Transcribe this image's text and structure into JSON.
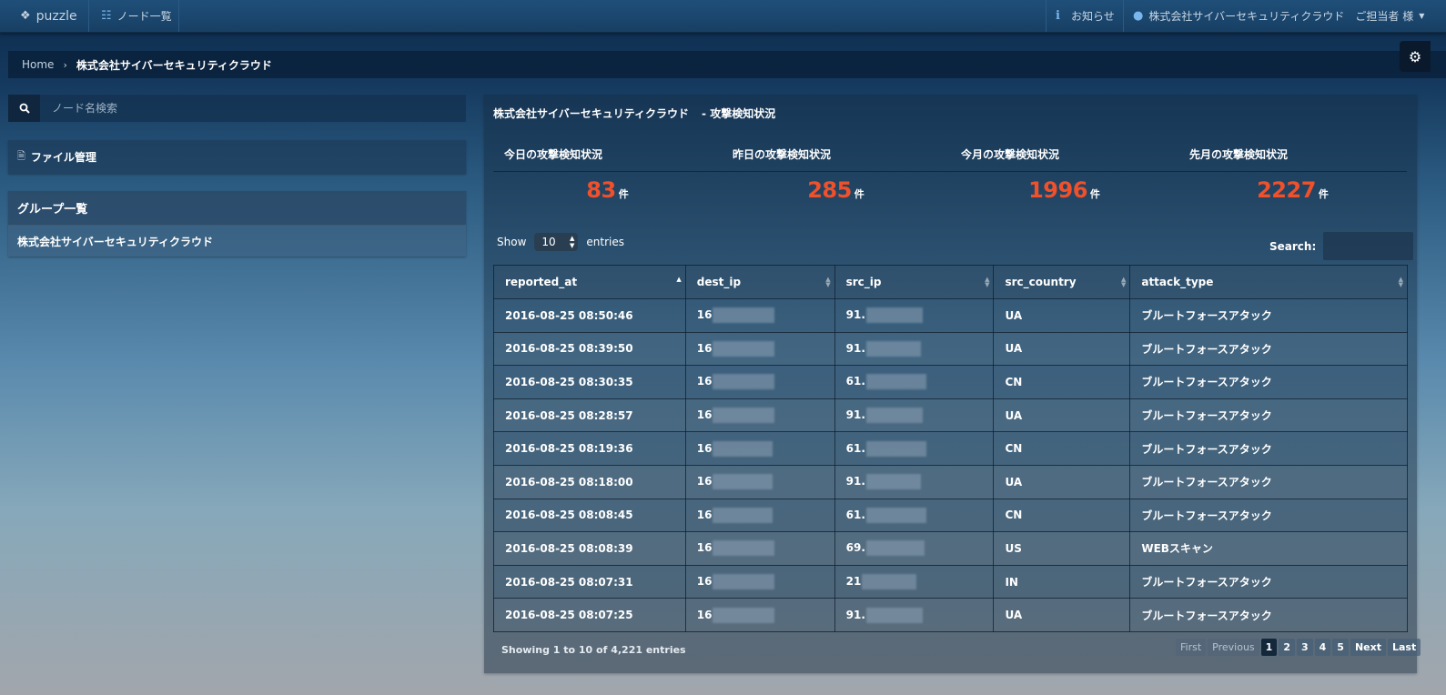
{
  "topbar": {
    "brand": "puzzle",
    "nodes_label": "ノード一覧",
    "notice_label": "お知らせ",
    "company_label": "株式会社サイバーセキュリティクラウド",
    "user_label": "ご担当者 様"
  },
  "breadcrumb": {
    "home": "Home",
    "current": "株式会社サイバーセキュリティクラウド"
  },
  "sidebar": {
    "search_placeholder": "ノード名検索",
    "file_label": "ファイル管理",
    "group_header": "グループ一覧",
    "group_item": "株式会社サイバーセキュリティクラウド"
  },
  "main": {
    "title_company": "株式会社サイバーセキュリティクラウド",
    "title_suffix": "- 攻撃検知状況",
    "stats": [
      {
        "label": "今日の攻撃検知状況",
        "value": "83",
        "unit": "件"
      },
      {
        "label": "昨日の攻撃検知状況",
        "value": "285",
        "unit": "件"
      },
      {
        "label": "今月の攻撃検知状況",
        "value": "1996",
        "unit": "件"
      },
      {
        "label": "先月の攻撃検知状況",
        "value": "2227",
        "unit": "件"
      }
    ],
    "show_label": "Show",
    "entries_select": "10",
    "entries_label": "entries",
    "search_label": "Search:",
    "columns": [
      "reported_at",
      "dest_ip",
      "src_ip",
      "src_country",
      "attack_type"
    ],
    "rows": [
      {
        "reported_at": "2016-08-25 08:50:46",
        "dest_ip": "16",
        "src_ip": "91.",
        "src_country": "UA",
        "attack_type": "ブルートフォースアタック"
      },
      {
        "reported_at": "2016-08-25 08:39:50",
        "dest_ip": "16",
        "src_ip": "91.",
        "src_country": "UA",
        "attack_type": "ブルートフォースアタック"
      },
      {
        "reported_at": "2016-08-25 08:30:35",
        "dest_ip": "16",
        "src_ip": "61.",
        "src_country": "CN",
        "attack_type": "ブルートフォースアタック"
      },
      {
        "reported_at": "2016-08-25 08:28:57",
        "dest_ip": "16",
        "src_ip": "91.",
        "src_country": "UA",
        "attack_type": "ブルートフォースアタック"
      },
      {
        "reported_at": "2016-08-25 08:19:36",
        "dest_ip": "16",
        "src_ip": "61.",
        "src_country": "CN",
        "attack_type": "ブルートフォースアタック"
      },
      {
        "reported_at": "2016-08-25 08:18:00",
        "dest_ip": "16",
        "src_ip": "91.",
        "src_country": "UA",
        "attack_type": "ブルートフォースアタック"
      },
      {
        "reported_at": "2016-08-25 08:08:45",
        "dest_ip": "16",
        "src_ip": "61.",
        "src_country": "CN",
        "attack_type": "ブルートフォースアタック"
      },
      {
        "reported_at": "2016-08-25 08:08:39",
        "dest_ip": "16",
        "src_ip": "69.",
        "src_country": "US",
        "attack_type": "WEBスキャン"
      },
      {
        "reported_at": "2016-08-25 08:07:31",
        "dest_ip": "16",
        "src_ip": "21",
        "src_country": "IN",
        "attack_type": "ブルートフォースアタック"
      },
      {
        "reported_at": "2016-08-25 08:07:25",
        "dest_ip": "16",
        "src_ip": "91.",
        "src_country": "UA",
        "attack_type": "ブルートフォースアタック"
      }
    ],
    "info": "Showing 1 to 10 of 4,221 entries",
    "pager": [
      "First",
      "Previous",
      "1",
      "2",
      "3",
      "4",
      "5",
      "Next",
      "Last"
    ]
  },
  "colors": {
    "accent_number": "#f0502a",
    "topbar": "#1f4f79"
  }
}
